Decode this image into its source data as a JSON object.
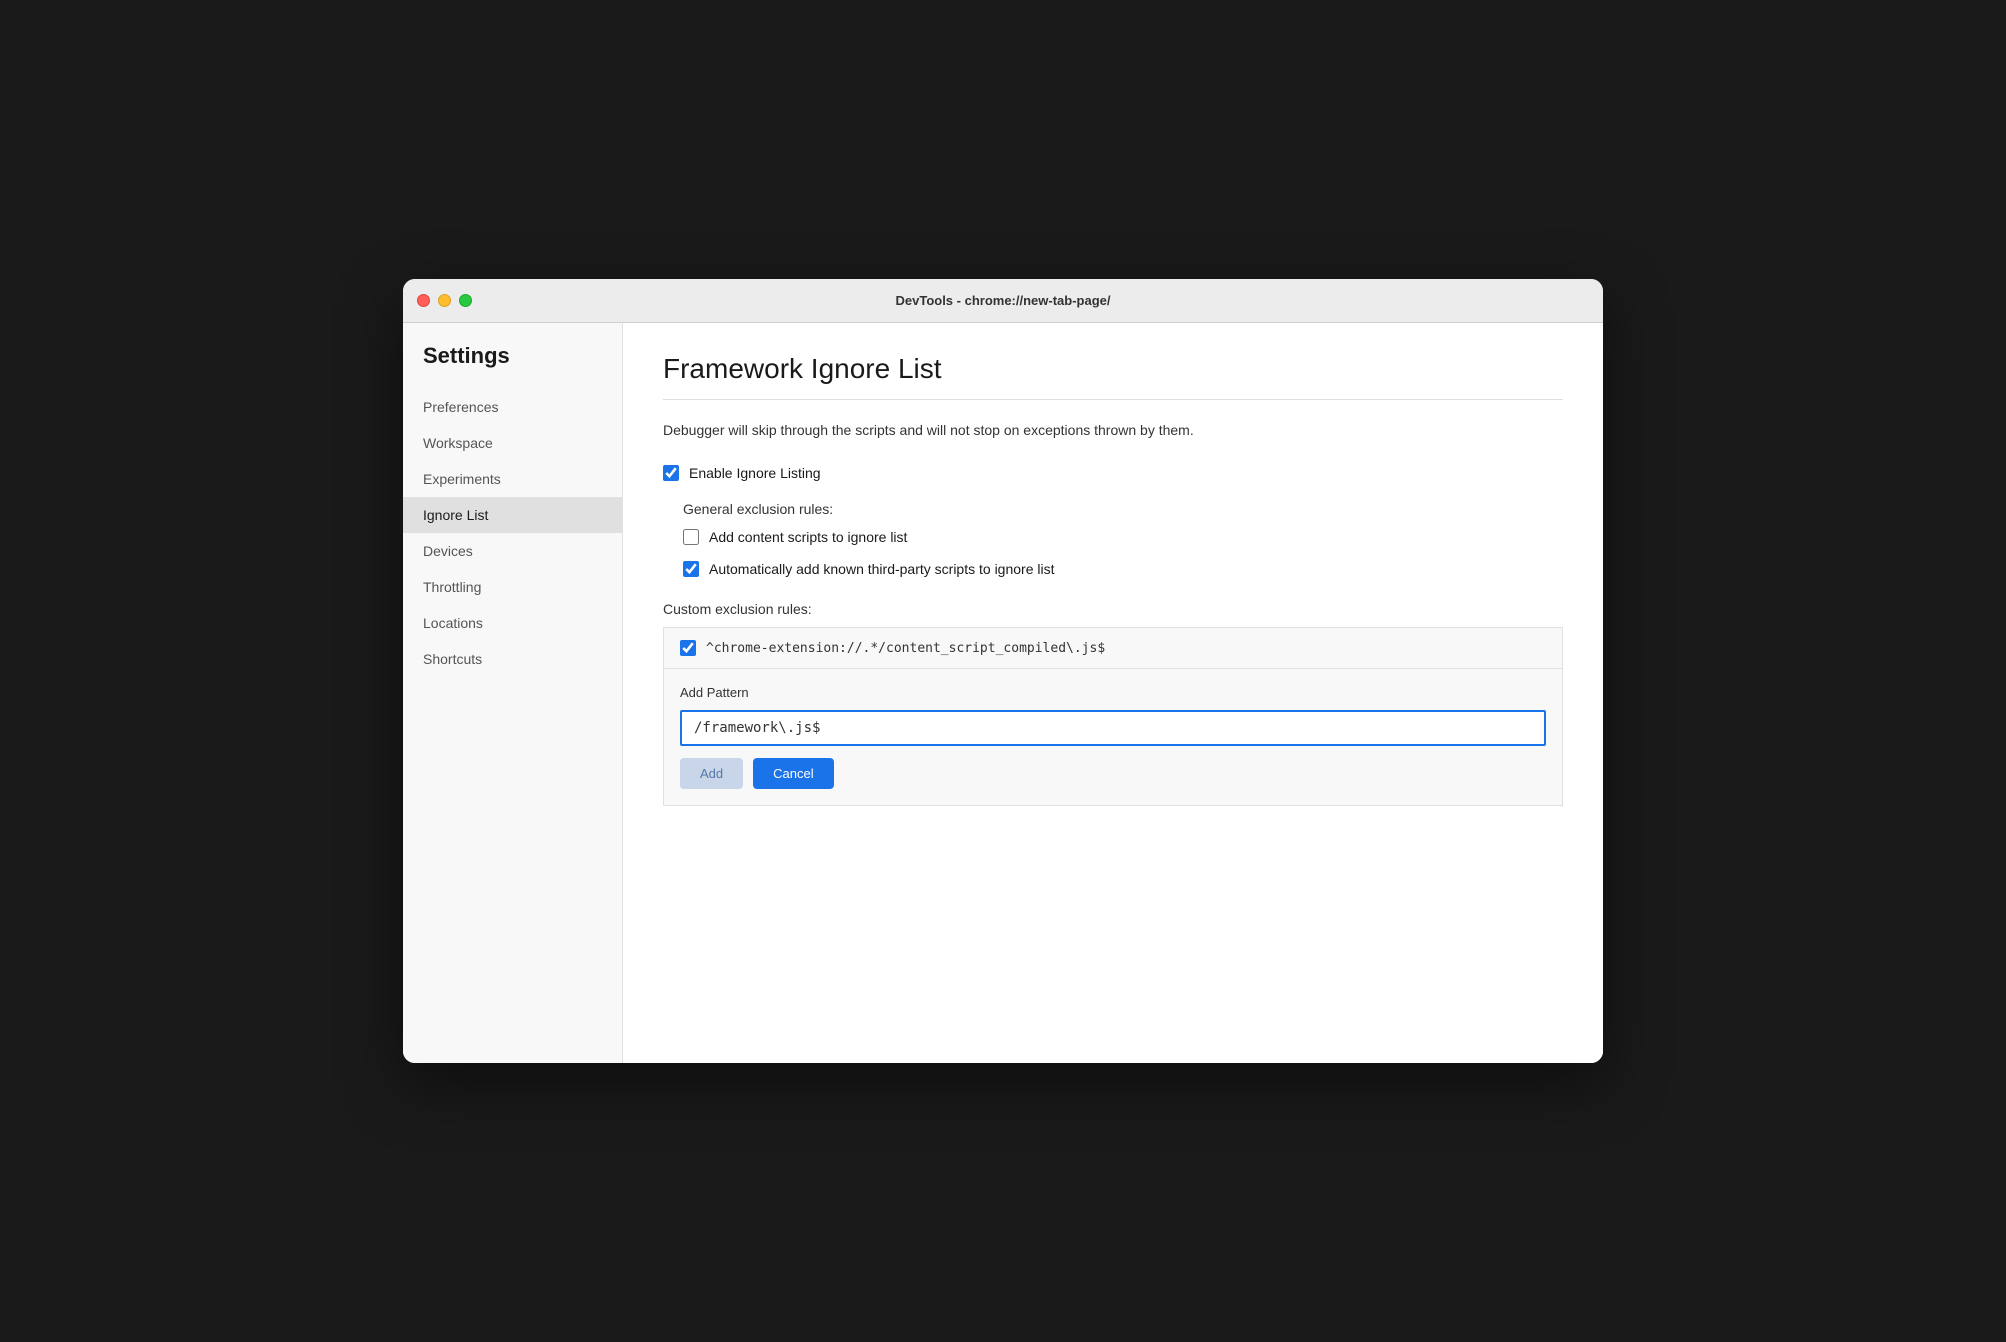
{
  "window": {
    "title": "DevTools - chrome://new-tab-page/"
  },
  "sidebar": {
    "heading": "Settings",
    "items": [
      {
        "id": "preferences",
        "label": "Preferences",
        "active": false
      },
      {
        "id": "workspace",
        "label": "Workspace",
        "active": false
      },
      {
        "id": "experiments",
        "label": "Experiments",
        "active": false
      },
      {
        "id": "ignore-list",
        "label": "Ignore List",
        "active": true
      },
      {
        "id": "devices",
        "label": "Devices",
        "active": false
      },
      {
        "id": "throttling",
        "label": "Throttling",
        "active": false
      },
      {
        "id": "locations",
        "label": "Locations",
        "active": false
      },
      {
        "id": "shortcuts",
        "label": "Shortcuts",
        "active": false
      }
    ]
  },
  "main": {
    "title": "Framework Ignore List",
    "description": "Debugger will skip through the scripts and will not stop on exceptions thrown by them.",
    "enable_ignore_listing_label": "Enable Ignore Listing",
    "enable_ignore_listing_checked": true,
    "general_exclusion_rules_label": "General exclusion rules:",
    "rule_add_content_scripts_label": "Add content scripts to ignore list",
    "rule_add_content_scripts_checked": false,
    "rule_auto_add_third_party_label": "Automatically add known third-party scripts to ignore list",
    "rule_auto_add_third_party_checked": true,
    "custom_exclusion_rules_label": "Custom exclusion rules:",
    "custom_rule_text": "^chrome-extension://.*/content_script_compiled\\.js$",
    "custom_rule_checked": true,
    "add_pattern_label": "Add Pattern",
    "pattern_input_value": "/framework\\.js$",
    "btn_add_label": "Add",
    "btn_cancel_label": "Cancel"
  }
}
